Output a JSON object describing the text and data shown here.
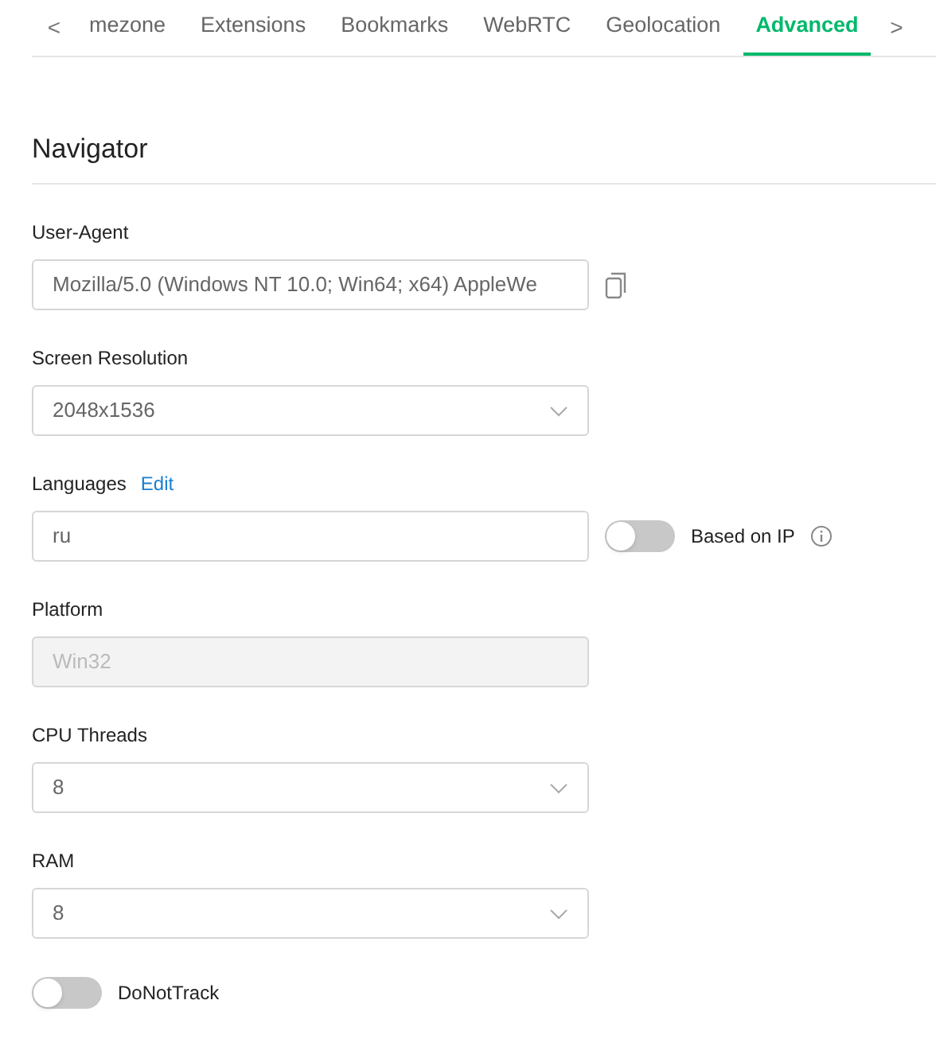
{
  "tabs": [
    {
      "label": "mezone",
      "selected": false
    },
    {
      "label": "Extensions",
      "selected": false
    },
    {
      "label": "Bookmarks",
      "selected": false
    },
    {
      "label": "WebRTC",
      "selected": false
    },
    {
      "label": "Geolocation",
      "selected": false
    },
    {
      "label": "Advanced",
      "selected": true
    }
  ],
  "tab_scroll": {
    "prev": "<",
    "next": ">"
  },
  "section": {
    "title": "Navigator"
  },
  "fields": [
    {
      "kind": "text",
      "label": "User-Agent",
      "value": "Mozilla/5.0 (Windows NT 10.0; Win64; x64) AppleWe",
      "copy": true
    },
    {
      "kind": "select",
      "label": "Screen Resolution",
      "value": "2048x1536"
    },
    {
      "kind": "text",
      "label": "Languages",
      "link": "Edit",
      "value": "ru",
      "toggle": {
        "label": "Based on IP",
        "on": false
      }
    },
    {
      "kind": "text",
      "label": "Platform",
      "value": "Win32",
      "disabled": true
    },
    {
      "kind": "select",
      "label": "CPU Threads",
      "value": "8"
    },
    {
      "kind": "select",
      "label": "RAM",
      "value": "8"
    }
  ],
  "do_not_track": {
    "label": "DoNotTrack",
    "on": false
  }
}
